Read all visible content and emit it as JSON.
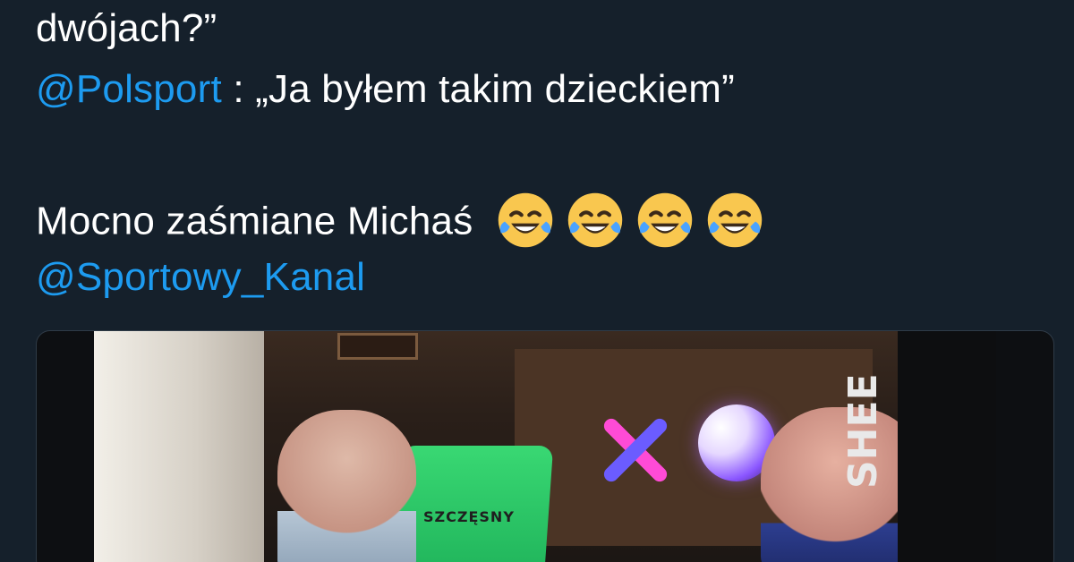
{
  "tweet": {
    "line1": "dwójach?”",
    "line2_mention": "@Polsport",
    "line2_text": " : „Ja byłem takim dzieckiem”",
    "line3_text": "Mocno zaśmiane Michaś",
    "line4_mention": "@Sportowy_Kanal",
    "emojis": [
      "face-with-tears-of-joy-emoji",
      "face-with-tears-of-joy-emoji",
      "face-with-tears-of-joy-emoji",
      "face-with-tears-of-joy-emoji"
    ]
  },
  "media": {
    "jersey_text": "SZCZĘSNY",
    "brand_text": "SHEE"
  },
  "colors": {
    "background": "#15202b",
    "text": "#ffffff",
    "mention": "#1d9bf0"
  }
}
